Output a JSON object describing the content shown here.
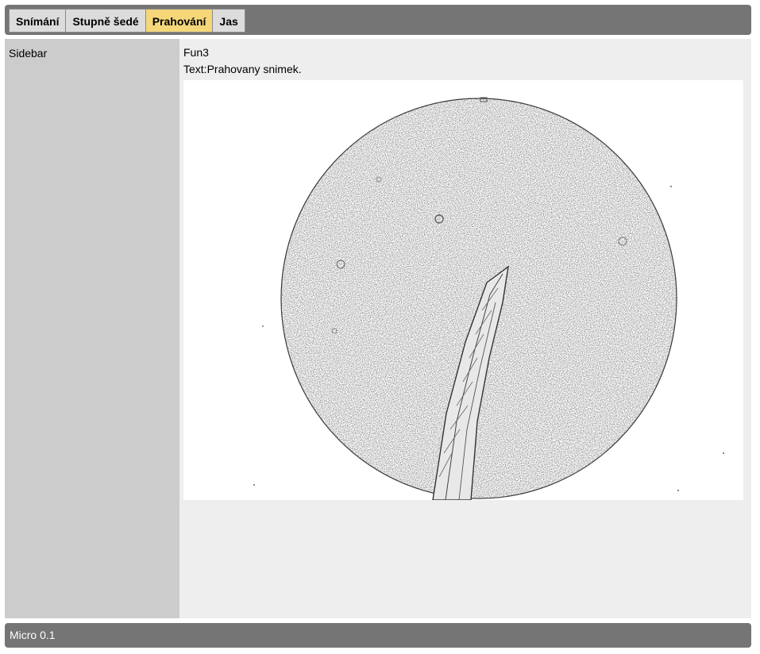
{
  "tabs": [
    {
      "label": "Snímání",
      "active": false
    },
    {
      "label": "Stupně šedé",
      "active": false
    },
    {
      "label": "Prahování",
      "active": true
    },
    {
      "label": "Jas",
      "active": false
    }
  ],
  "sidebar": {
    "label": "Sidebar"
  },
  "content": {
    "heading": "Fun3",
    "text": "Text:Prahovany snimek."
  },
  "footer": {
    "label": "Micro 0.1"
  },
  "colors": {
    "active_tab": "#f5d77a",
    "bar": "#757575",
    "sidebar": "#cccccc",
    "content_bg": "#eeeeee"
  }
}
